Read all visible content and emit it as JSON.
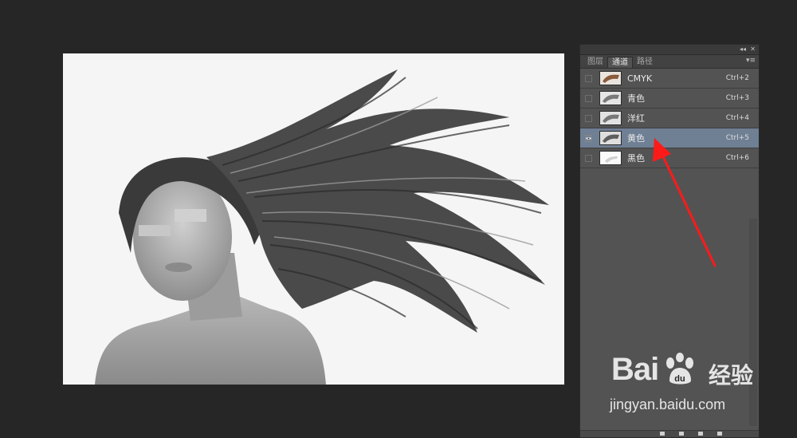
{
  "panel": {
    "tabs": [
      {
        "label": "图层",
        "active": false
      },
      {
        "label": "通道",
        "active": true
      },
      {
        "label": "路径",
        "active": false
      }
    ],
    "collapse_glyph": "◂◂",
    "close_glyph": "✕",
    "menu_glyph": "▾≡",
    "channels": [
      {
        "name": "CMYK",
        "shortcut": "Ctrl+2",
        "visible": false,
        "selected": false,
        "thumb_color": "#8a5a3a"
      },
      {
        "name": "青色",
        "shortcut": "Ctrl+3",
        "visible": false,
        "selected": false,
        "thumb_color": "#7a7a7a"
      },
      {
        "name": "洋红",
        "shortcut": "Ctrl+4",
        "visible": false,
        "selected": false,
        "thumb_color": "#777777"
      },
      {
        "name": "黄色",
        "shortcut": "Ctrl+5",
        "visible": true,
        "selected": true,
        "thumb_color": "#6a6a6a"
      },
      {
        "name": "黑色",
        "shortcut": "Ctrl+6",
        "visible": false,
        "selected": false,
        "thumb_color": "#d8d8d8"
      }
    ]
  },
  "colors": {
    "selected_row": "#6f7f94",
    "annotation_arrow": "#ff1a1a"
  },
  "watermark": {
    "logo_text": "Bai",
    "logo_text_2": "经验",
    "url": "jingyan.baidu.com"
  }
}
